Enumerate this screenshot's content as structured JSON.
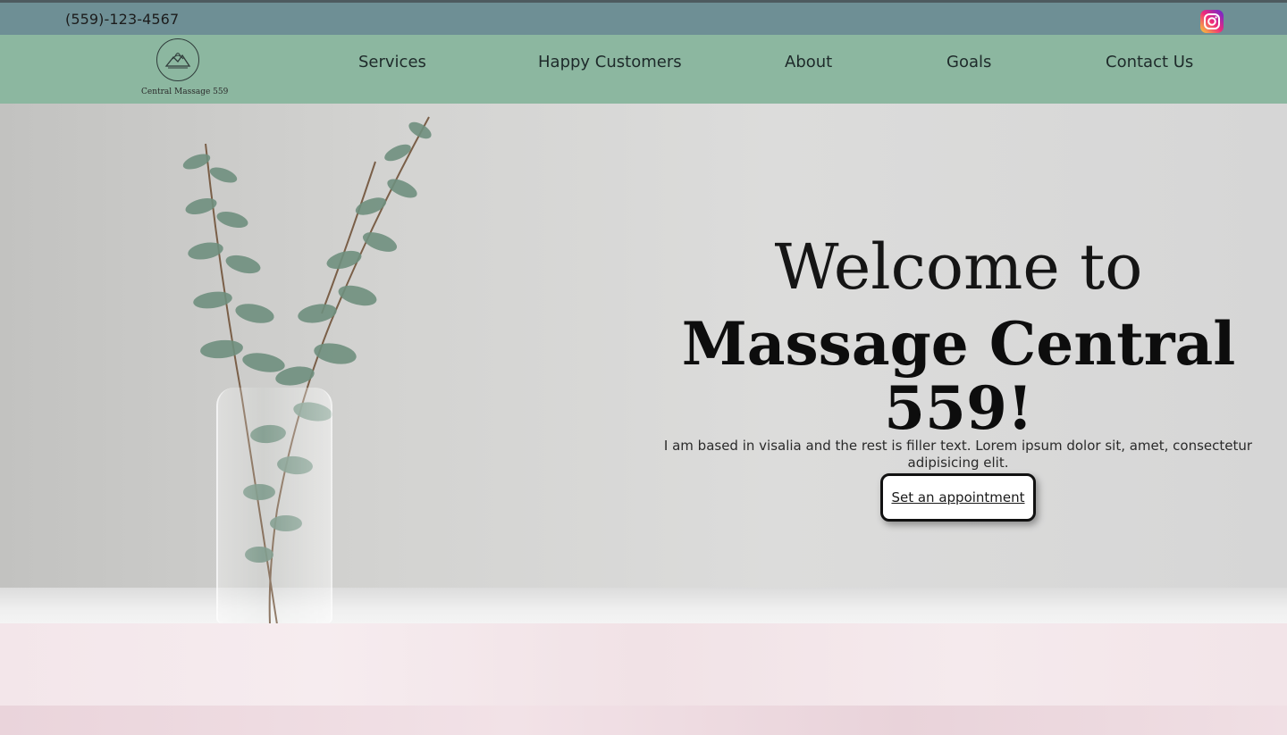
{
  "topbar": {
    "phone": "(559)-123-4567",
    "social_icon": "instagram-icon"
  },
  "navbar": {
    "logo_text": "Central Massage 559",
    "logo_icon": "mountain-lotus-logo",
    "items": [
      {
        "label": "Services"
      },
      {
        "label": "Happy Customers"
      },
      {
        "label": "About"
      },
      {
        "label": "Goals"
      },
      {
        "label": "Contact Us"
      }
    ]
  },
  "hero": {
    "welcome": "Welcome to",
    "brand": "Massage Central 559!",
    "description": "I am based in visalia and the rest is filler text. Lorem ipsum dolor sit, amet, consectetur adipisicing elit.",
    "cta_label": "Set an appointment",
    "image": "eucalyptus-in-glass-vase"
  },
  "colors": {
    "topbar": "#6e8f95",
    "navbar": "#8cb7a0",
    "text": "#151515",
    "lower_section": "#f3e6ea"
  }
}
